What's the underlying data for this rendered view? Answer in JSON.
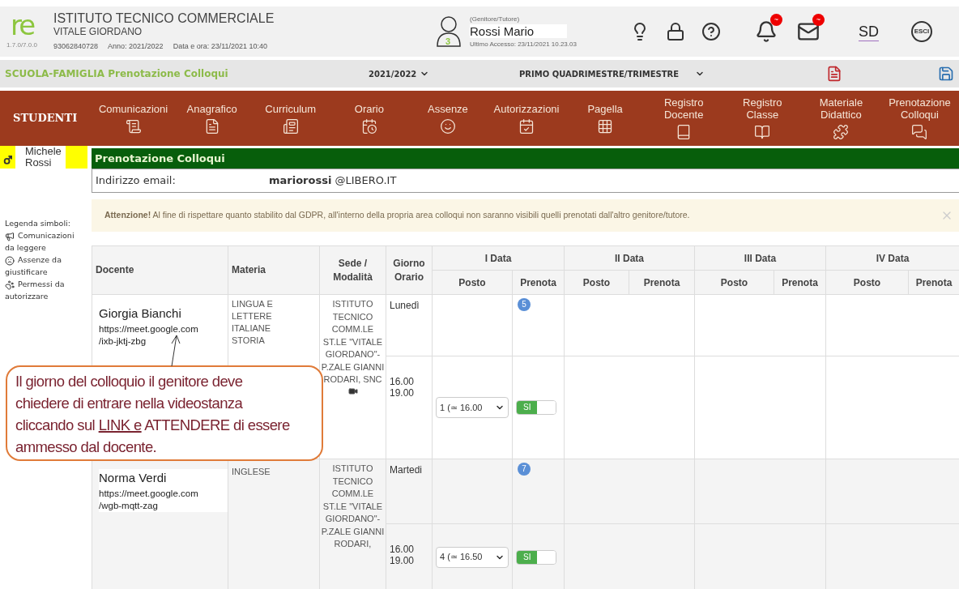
{
  "header": {
    "logo": "re",
    "version": "1.7.0/7.0.0",
    "school_name": "ISTITUTO TECNICO COMMERCIALE",
    "school_subname": "VITALE GIORDANO",
    "tax_code": "93062840728",
    "year": "Anno: 2021/2022",
    "datetime": "Data e ora: 23/11/2021 10:40"
  },
  "user": {
    "children_count": "3",
    "role": "(Genitore/Tutore)",
    "name": "Rossi Mario",
    "last_access": "Ultimo Accesso: 23/11/2021 10.23.03"
  },
  "notifications": [
    {
      "badge": "~"
    },
    {
      "badge": "~"
    }
  ],
  "brand": "SD",
  "logout": "ESCI",
  "bar": {
    "title": "SCUOLA-FAMIGLIA Prenotazione Colloqui",
    "year": "2021/2022",
    "period": "PRIMO QUADRIMESTRE/TRIMESTRE"
  },
  "nav": {
    "section": "STUDENTI",
    "items": [
      "Comunicazioni",
      "Anagrafico",
      "Curriculum",
      "Orario",
      "Assenze",
      "Autorizzazioni",
      "Pagella",
      "Registro Docente",
      "Registro Classe",
      "Materiale Didattico",
      "Prenotazione Colloqui"
    ]
  },
  "student": {
    "name": "Michele Rossi"
  },
  "legend": {
    "title": "Legenda simboli:",
    "items": [
      {
        "kind": "megaphone",
        "label": "Comunicazioni da leggere"
      },
      {
        "kind": "absence",
        "label": "Assenze da giustificare"
      },
      {
        "kind": "paw",
        "label": "Permessi da autorizzare"
      }
    ]
  },
  "panel": {
    "title": "Prenotazione Colloqui",
    "email_label": "Indirizzo email:",
    "email": "**mariorossi** @LIBERO.IT"
  },
  "alert": {
    "text": "**Attenzione!** Al fine di rispettare quanto stabilito dal GDPR, all'interno della propria area colloqui non saranno visibili quelli prenotati dall'altro genitore/tutore."
  },
  "table": {
    "columns": [
      "Docente",
      "Materia",
      "Sede / Modalità",
      "Giorno Orario"
    ],
    "date_groups": [
      {
        "label": "I Data",
        "columns": [
          "Posto",
          "Prenota"
        ]
      },
      {
        "label": "II Data",
        "columns": [
          "Posto",
          "Prenota"
        ]
      },
      {
        "label": "III Data",
        "columns": [
          "Posto",
          "Prenota"
        ]
      },
      {
        "label": "IV Data",
        "columns": [
          "Posto",
          "Prenota"
        ]
      }
    ],
    "rows": [
      {
        "teacher": "Giorgia Bianchi",
        "link": "https://meet.google.com/ixb-jktj-zbg",
        "subject": "LINGUA E LETTERE ITALIANE STORIA",
        "location": "ISTITUTO TECNICO COMM.LE ST.LE \"VITALE GIORDANO\"- P.ZALE GIANNI RODARI, SNC",
        "video_call": true,
        "day": "Lunedì",
        "slots": "5",
        "hours": "16.00 19.00",
        "slot_choice": "1 (≃ 16.00",
        "booked": true,
        "toggle_label": "SI"
      },
      {
        "teacher": "Norma Verdi",
        "link": "https://meet.google.com/wgb-mqtt-zag",
        "subject": "INGLESE",
        "location": "ISTITUTO TECNICO COMM.LE ST.LE \"VITALE GIORDANO\"- P.ZALE GIANNI RODARI,",
        "day": "Martedi",
        "slots": "7",
        "hours": "16.00 19.00",
        "slot_choice": "4 (≃ 16.50",
        "booked": true,
        "toggle_label": "SI"
      }
    ]
  },
  "callout": {
    "before": "Il giorno del colloquio il genitore deve chiedere di entrare nella videostanza cliccando sul ",
    "underlined": "LINK e",
    "after": " ATTENDERE di essere ammesso dal docente."
  }
}
